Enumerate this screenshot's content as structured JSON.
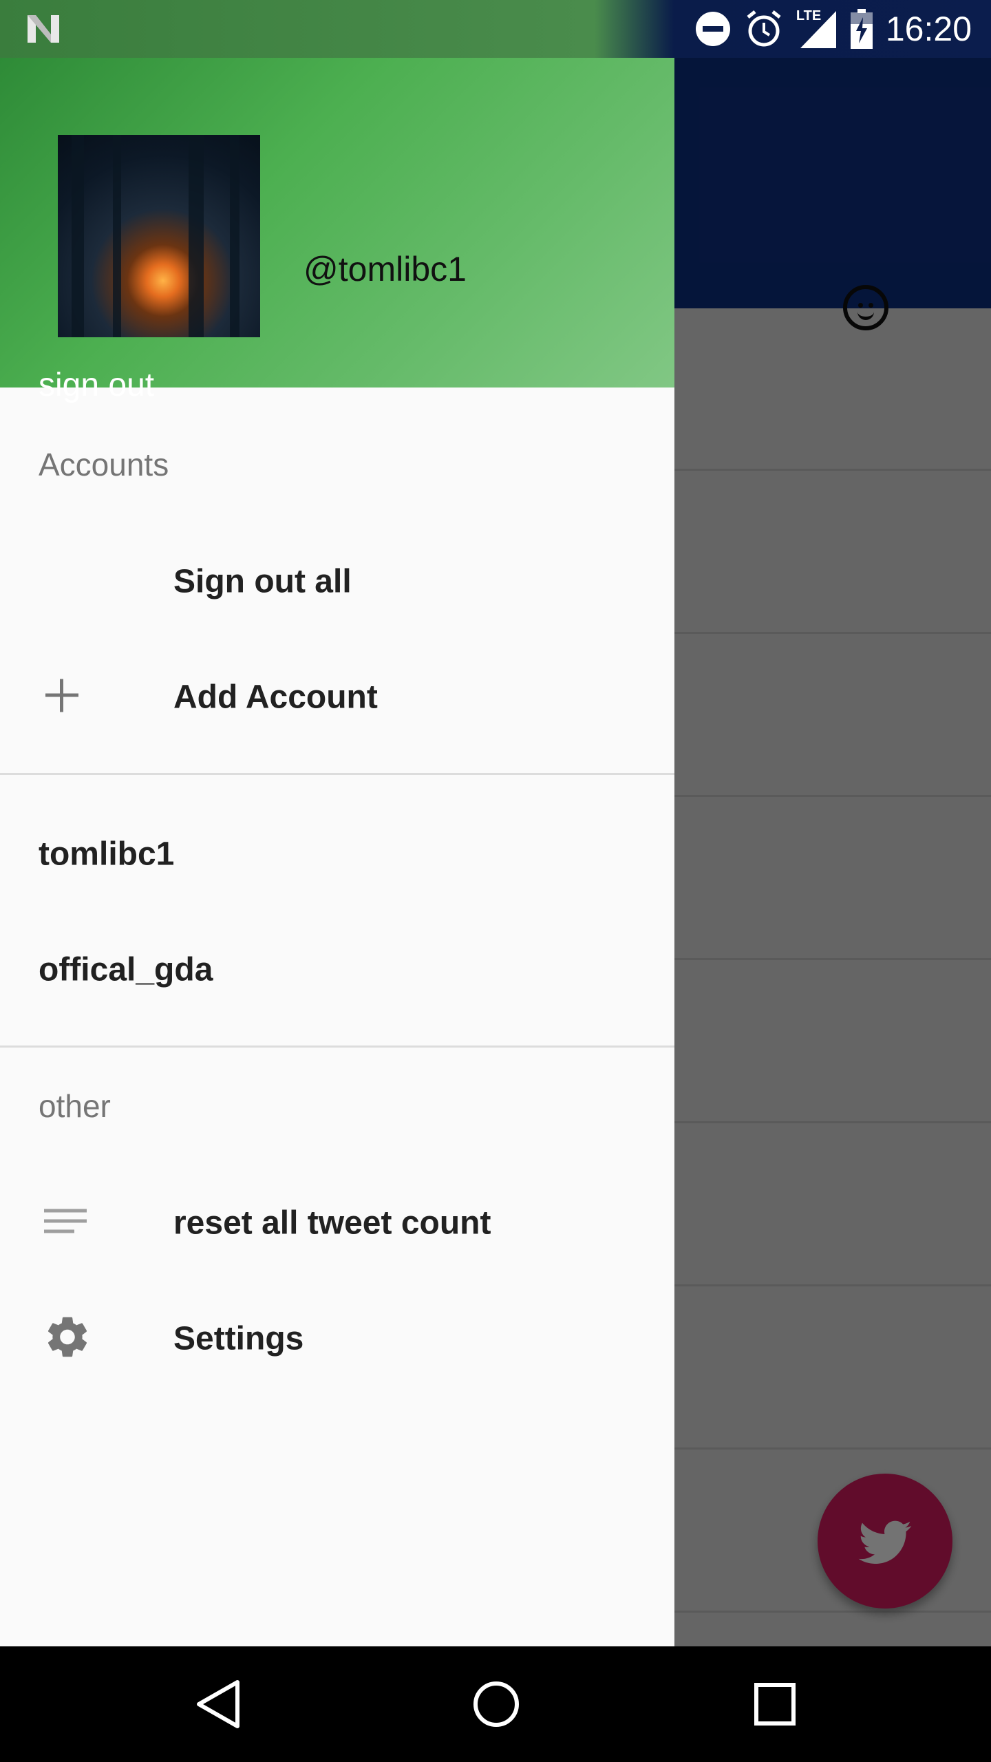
{
  "status_bar": {
    "time": "16:20",
    "network_label": "LTE",
    "icons": [
      "n-logo-icon",
      "do-not-disturb-icon",
      "alarm-icon",
      "signal-icon",
      "battery-charging-icon"
    ]
  },
  "drawer": {
    "header": {
      "username": "@tomlibc1",
      "sign_out_label": "sign out",
      "gradient_colors": [
        "#2e8b37",
        "#4caf50",
        "#81c784"
      ]
    },
    "accounts_section": {
      "title": "Accounts",
      "items": [
        {
          "label": "Sign out all",
          "icon": null
        },
        {
          "label": "Add Account",
          "icon": "plus-icon"
        }
      ]
    },
    "account_list": [
      {
        "label": "tomlibc1"
      },
      {
        "label": "offical_gda"
      }
    ],
    "other_section": {
      "title": "other",
      "items": [
        {
          "label": "reset all tweet count",
          "icon": "lines-icon"
        },
        {
          "label": "Settings",
          "icon": "gear-icon"
        }
      ]
    }
  },
  "background_app": {
    "toolbar_color": "#0d2f82",
    "toolbar_icon": "smiley-icon",
    "fab_icon": "twitter-bird-icon",
    "fab_color": "#d81b60"
  },
  "nav_bar": {
    "buttons": [
      "back-icon",
      "home-icon",
      "recents-icon"
    ]
  }
}
